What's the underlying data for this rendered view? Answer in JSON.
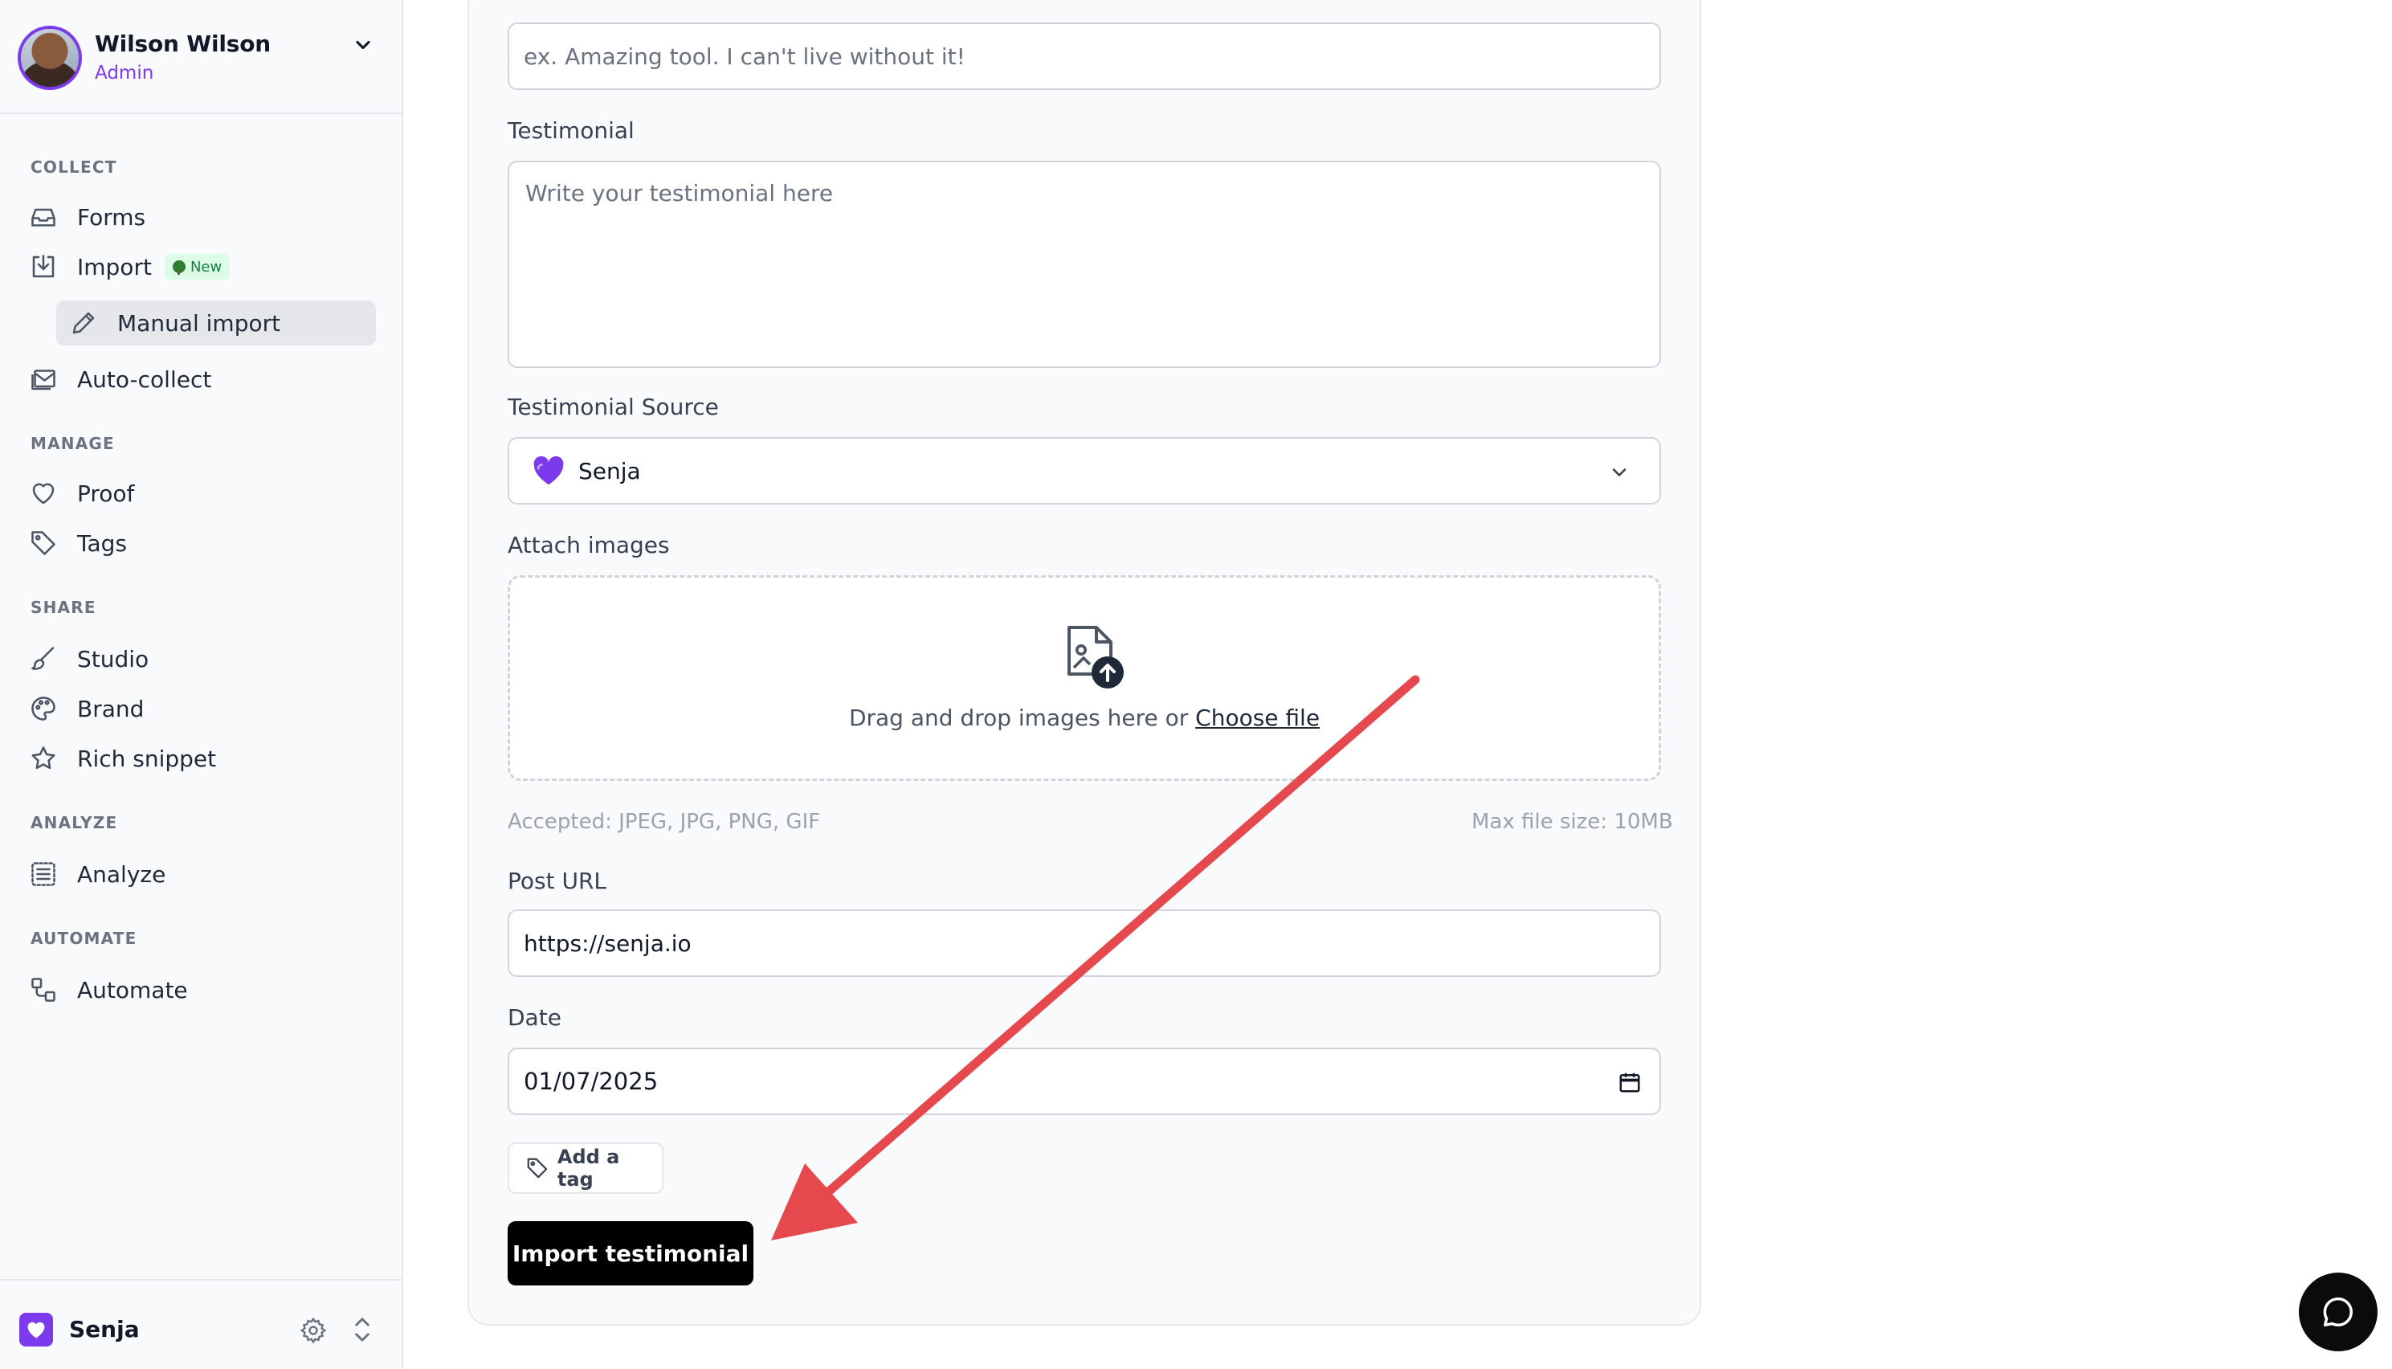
{
  "user": {
    "name": "Wilson Wilson",
    "role": "Admin"
  },
  "sidebar": {
    "sections": {
      "collect": "COLLECT",
      "manage": "MANAGE",
      "share": "SHARE",
      "analyze": "ANALYZE",
      "automate": "AUTOMATE"
    },
    "items": {
      "forms": "Forms",
      "import": "Import",
      "import_badge": "New",
      "manual_import": "Manual import",
      "auto_collect": "Auto-collect",
      "proof": "Proof",
      "tags": "Tags",
      "studio": "Studio",
      "brand": "Brand",
      "rich_snippet": "Rich snippet",
      "analyze": "Analyze",
      "automate": "Automate"
    },
    "workspace": "Senja"
  },
  "form": {
    "title_placeholder": "ex. Amazing tool. I can't live without it!",
    "testimonial_label": "Testimonial",
    "testimonial_placeholder": "Write your testimonial here",
    "source_label": "Testimonial Source",
    "source_value": "Senja",
    "attach_label": "Attach images",
    "dropzone_text": "Drag and drop images here or ",
    "dropzone_link": "Choose file",
    "accepted_hint": "Accepted: JPEG, JPG, PNG, GIF",
    "max_size_hint": "Max file size: 10MB",
    "post_url_label": "Post URL",
    "post_url_value": "https://senja.io",
    "date_label": "Date",
    "date_value": "01/07/2025",
    "add_tag_label": "Add a tag",
    "submit_label": "Import testimonial"
  },
  "colors": {
    "accent": "#7c3aed",
    "annotation_arrow": "#e5484d",
    "primary_button": "#000000"
  }
}
